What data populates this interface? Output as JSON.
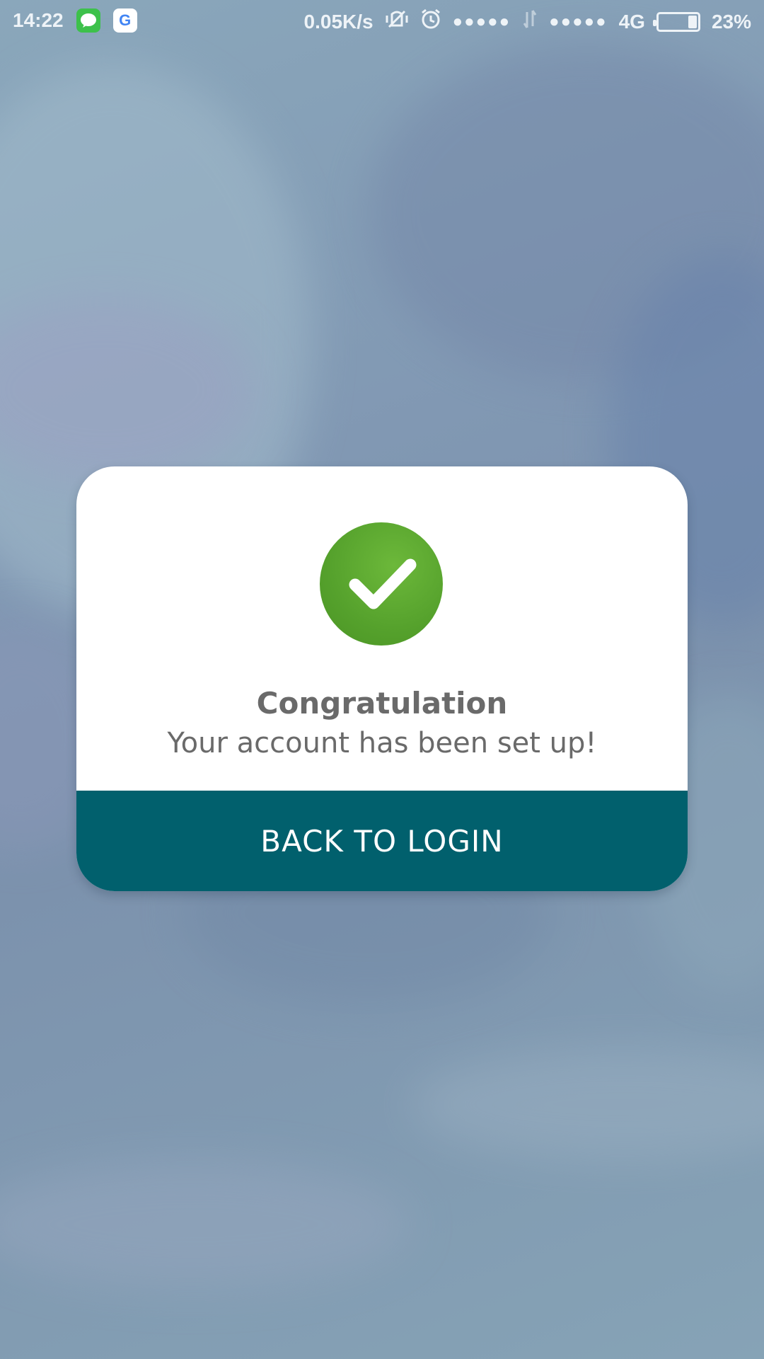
{
  "status_bar": {
    "time": "14:22",
    "speed": "0.05K/s",
    "signal1": "●●●●●",
    "signal2": "●●●●●",
    "network": "4G",
    "battery_percent": "23%",
    "battery_level": 0.23,
    "icons": [
      "messages-app-icon",
      "google-app-icon",
      "vibrate-off-icon",
      "alarm-icon",
      "data-arrows-icon",
      "battery-icon"
    ]
  },
  "dialog": {
    "icon": "check-circle-icon",
    "icon_color": "#55a12c",
    "title": "Congratulation",
    "message": "Your account has been set up!",
    "button_label": "BACK TO LOGIN",
    "button_color": "#01606d"
  }
}
